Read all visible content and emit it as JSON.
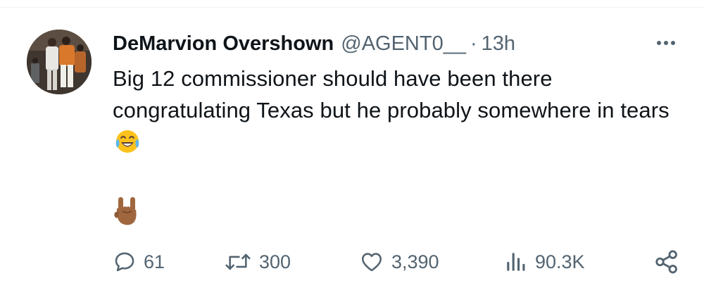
{
  "tweet": {
    "display_name": "DeMarvion Overshown",
    "handle": "@AGENT0__",
    "separator": "·",
    "time": "13h",
    "text": "Big 12 commissioner should have been there congratulating Texas but he probably somewhere in tears",
    "emoji_inline": "face-with-tears-of-joy-icon",
    "emoji_standalone": "sign-of-the-horns-icon"
  },
  "actions": {
    "replies": "61",
    "reposts": "300",
    "likes": "3,390",
    "views": "90.3K"
  },
  "colors": {
    "text": "#0f1419",
    "secondary": "#536471",
    "emoji_yellow": "#fcc21b",
    "emoji_tear": "#5eb8ea",
    "hand_skin": "#a0673f"
  }
}
